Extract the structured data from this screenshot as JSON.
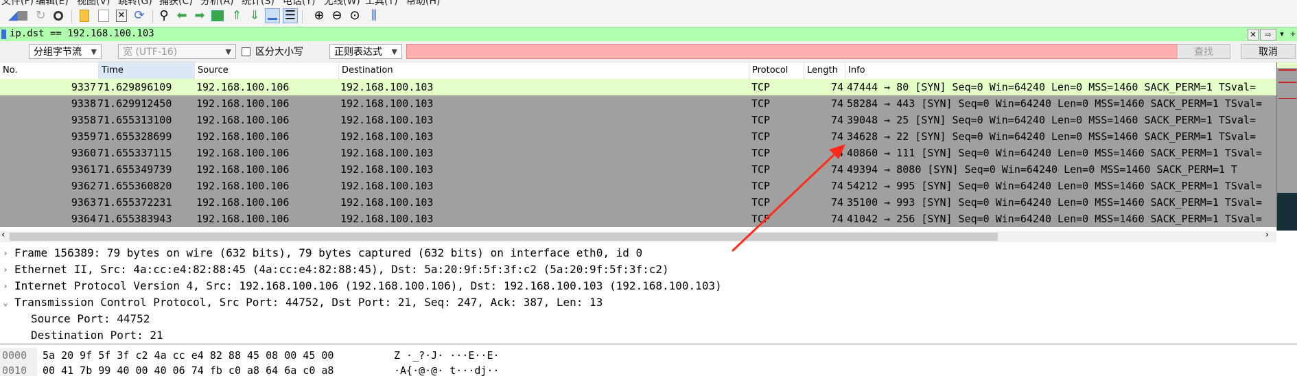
{
  "toolbar": {
    "icons": [
      "start-capture-icon",
      "stop-capture-icon",
      "restart-capture-icon",
      "capture-options-icon",
      "open-file-icon",
      "save-file-icon",
      "close-file-icon",
      "reload-icon",
      "find-packet-icon",
      "go-back-icon",
      "go-forward-icon",
      "go-to-packet-icon",
      "go-first-icon",
      "go-last-icon",
      "autoscroll-icon",
      "colorize-icon",
      "zoom-in-icon",
      "zoom-out-icon",
      "zoom-normal-icon",
      "resize-columns-icon"
    ]
  },
  "display_filter": {
    "value": "ip.dst == 192.168.100.103",
    "bg_color": "#afffaf"
  },
  "find_bar": {
    "search_in": "分组字节流",
    "charset": "宽 (UTF-16)",
    "case_label": "区分大小写",
    "search_type": "正则表达式",
    "search_value": "",
    "find_button": "查找",
    "cancel_button": "取消",
    "search_bg": "#ffafaf"
  },
  "packet_list": {
    "columns": [
      "No.",
      "Time",
      "Source",
      "Destination",
      "Protocol",
      "Length",
      "Info"
    ],
    "rows": [
      {
        "no": "9337",
        "time": "71.629896109",
        "src": "192.168.100.106",
        "dst": "192.168.100.103",
        "proto": "TCP",
        "len": "74",
        "info": "47444 → 80 [SYN] Seq=0 Win=64240 Len=0 MSS=1460 SACK_PERM=1 TSval=",
        "selected": true
      },
      {
        "no": "9338",
        "time": "71.629912450",
        "src": "192.168.100.106",
        "dst": "192.168.100.103",
        "proto": "TCP",
        "len": "74",
        "info": "58284 → 443 [SYN] Seq=0 Win=64240 Len=0 MSS=1460 SACK_PERM=1 TSval="
      },
      {
        "no": "9358",
        "time": "71.655313100",
        "src": "192.168.100.106",
        "dst": "192.168.100.103",
        "proto": "TCP",
        "len": "74",
        "info": "39048 → 25 [SYN] Seq=0 Win=64240 Len=0 MSS=1460 SACK_PERM=1 TSval="
      },
      {
        "no": "9359",
        "time": "71.655328699",
        "src": "192.168.100.106",
        "dst": "192.168.100.103",
        "proto": "TCP",
        "len": "74",
        "info": "34628 → 22 [SYN] Seq=0 Win=64240 Len=0 MSS=1460 SACK_PERM=1 TSval="
      },
      {
        "no": "9360",
        "time": "71.655337115",
        "src": "192.168.100.106",
        "dst": "192.168.100.103",
        "proto": "TCP",
        "len": "74",
        "info": "40860 → 111 [SYN] Seq=0 Win=64240 Len=0 MSS=1460 SACK_PERM=1 TSval="
      },
      {
        "no": "9361",
        "time": "71.655349739",
        "src": "192.168.100.106",
        "dst": "192.168.100.103",
        "proto": "TCP",
        "len": "74",
        "info": "49394 → 8080 [SYN] Seq=0 Win=64240 Len=0 MSS=1460 SACK_PERM=1 T"
      },
      {
        "no": "9362",
        "time": "71.655360820",
        "src": "192.168.100.106",
        "dst": "192.168.100.103",
        "proto": "TCP",
        "len": "74",
        "info": "54212 → 995 [SYN] Seq=0 Win=64240 Len=0 MSS=1460 SACK_PERM=1 TSval="
      },
      {
        "no": "9363",
        "time": "71.655372231",
        "src": "192.168.100.106",
        "dst": "192.168.100.103",
        "proto": "TCP",
        "len": "74",
        "info": "35100 → 993 [SYN] Seq=0 Win=64240 Len=0 MSS=1460 SACK_PERM=1 TSval="
      },
      {
        "no": "9364",
        "time": "71.655383943",
        "src": "192.168.100.106",
        "dst": "192.168.100.103",
        "proto": "TCP",
        "len": "74",
        "info": "41042 → 256 [SYN] Seq=0 Win=64240 Len=0 MSS=1460 SACK_PERM=1 TSval="
      }
    ],
    "selected_bg": "#e4ffc7",
    "row_bg": "#a0a0a0"
  },
  "details": [
    {
      "text": "Frame 156389: 79 bytes on wire (632 bits), 79 bytes captured (632 bits) on interface eth0, id 0",
      "expanded": false
    },
    {
      "text": "Ethernet II, Src: 4a:cc:e4:82:88:45 (4a:cc:e4:82:88:45), Dst: 5a:20:9f:5f:3f:c2 (5a:20:9f:5f:3f:c2)",
      "expanded": false
    },
    {
      "text": "Internet Protocol Version 4, Src: 192.168.100.106 (192.168.100.106), Dst: 192.168.100.103 (192.168.100.103)",
      "expanded": false
    },
    {
      "text": "Transmission Control Protocol, Src Port: 44752, Dst Port: 21, Seq: 247, Ack: 387, Len: 13",
      "expanded": true
    },
    {
      "text": "Source Port: 44752",
      "child": true
    },
    {
      "text": "Destination Port: 21",
      "child": true
    }
  ],
  "bytes": [
    {
      "offset": "0000",
      "hex": "5a 20 9f 5f 3f c2 4a cc  e4 82 88 45 08 00 45 00",
      "ascii": "Z ·_?·J·  ···E··E·"
    },
    {
      "offset": "0010",
      "hex": "00 41 7b 99 40 00 40 06  74 fb c0 a8 64 6a c0 a8",
      "ascii": "·A{·@·@·  t···dj··"
    }
  ],
  "annotation_color": "#ff2a1a"
}
